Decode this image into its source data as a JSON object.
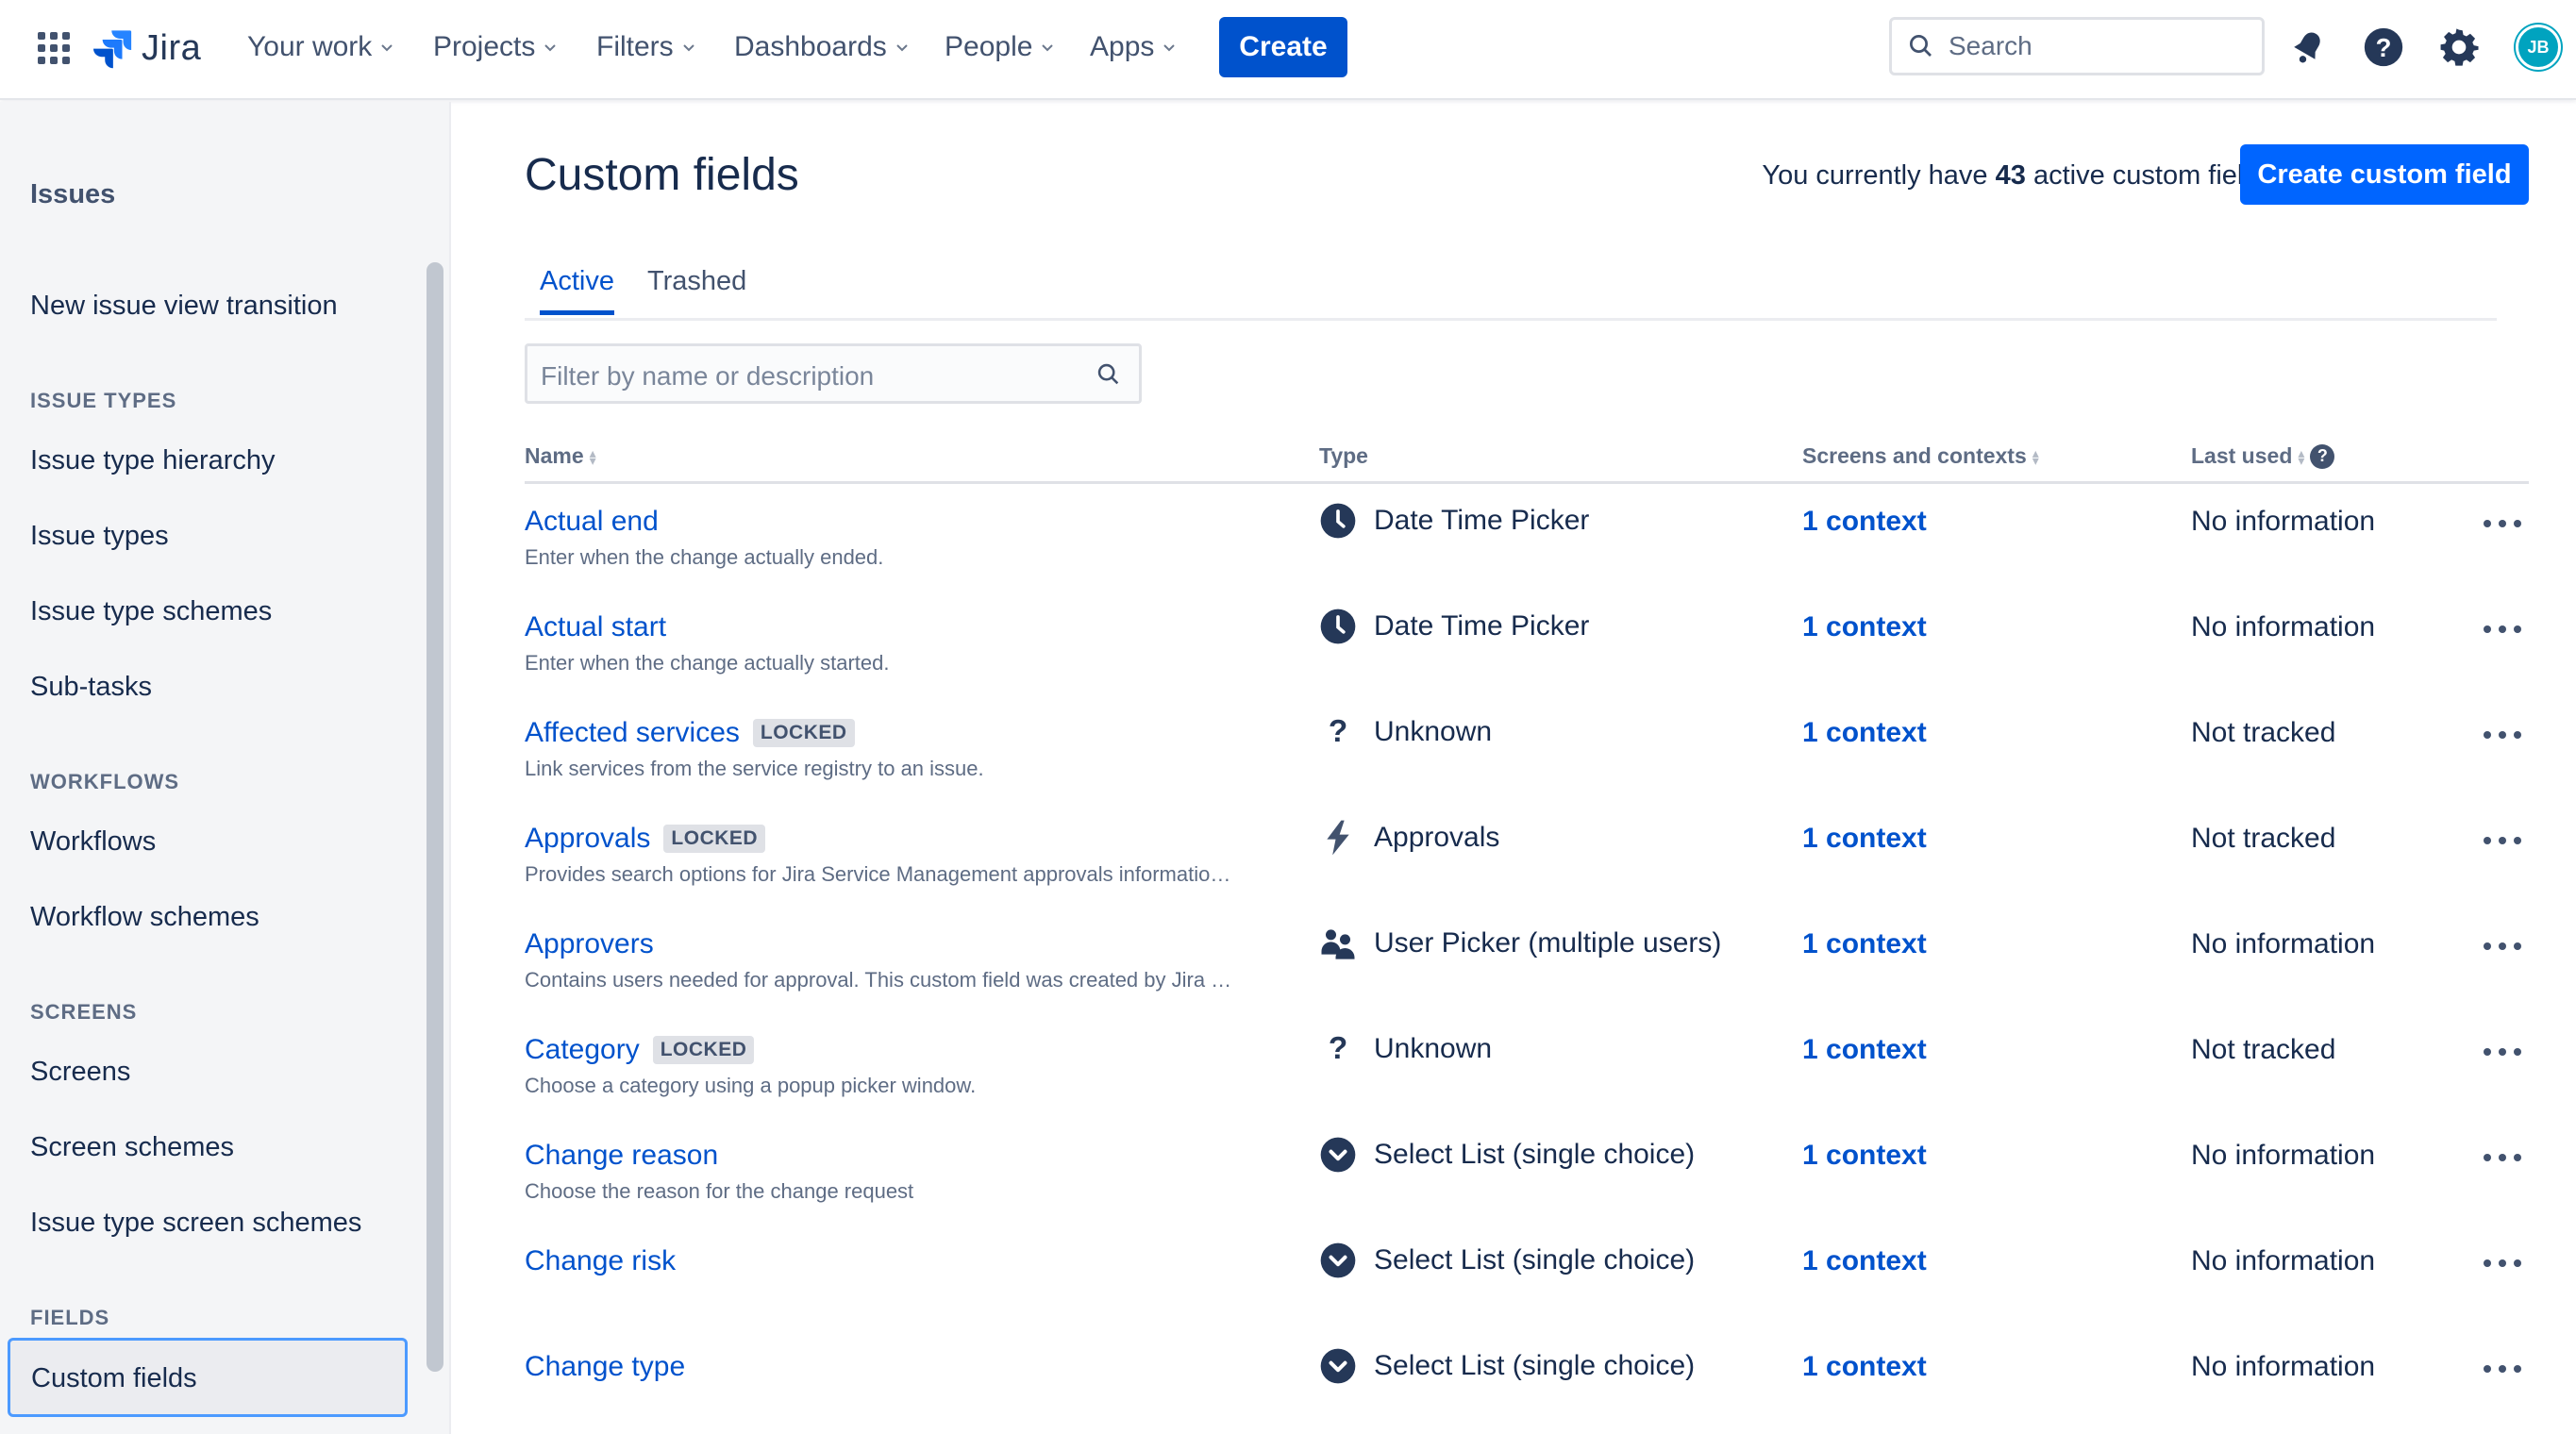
{
  "nav": {
    "product": "Jira",
    "items": [
      "Your work",
      "Projects",
      "Filters",
      "Dashboards",
      "People",
      "Apps"
    ],
    "create_label": "Create",
    "search_placeholder": "Search",
    "avatar_initials": "JB",
    "icons": [
      "app-switcher-icon",
      "jira-logo-icon",
      "notifications-icon",
      "help-icon",
      "settings-icon"
    ]
  },
  "sidebar": {
    "title": "Issues",
    "top_item": "New issue view transition",
    "sections": [
      {
        "heading": "ISSUE TYPES",
        "items": [
          "Issue type hierarchy",
          "Issue types",
          "Issue type schemes",
          "Sub-tasks"
        ]
      },
      {
        "heading": "WORKFLOWS",
        "items": [
          "Workflows",
          "Workflow schemes"
        ]
      },
      {
        "heading": "SCREENS",
        "items": [
          "Screens",
          "Screen schemes",
          "Issue type screen schemes"
        ]
      },
      {
        "heading": "FIELDS",
        "items": [
          "Custom fields"
        ]
      }
    ],
    "selected": "Custom fields"
  },
  "main": {
    "title": "Custom fields",
    "count_prefix": "You currently have",
    "count_value": "43",
    "count_suffix": "active custom fields",
    "create_button": "Create custom field",
    "tabs": [
      "Active",
      "Trashed"
    ],
    "active_tab": "Active",
    "filter_placeholder": "Filter by name or description",
    "columns": [
      "Name",
      "Type",
      "Screens and contexts",
      "Last used"
    ]
  },
  "rows": [
    {
      "name": "Actual end",
      "locked": false,
      "description": "Enter when the change actually ended.",
      "type": "Date Time Picker",
      "type_icon": "clock-icon",
      "context": "1 context",
      "last_used": "No information"
    },
    {
      "name": "Actual start",
      "locked": false,
      "description": "Enter when the change actually started.",
      "type": "Date Time Picker",
      "type_icon": "clock-icon",
      "context": "1 context",
      "last_used": "No information"
    },
    {
      "name": "Affected services",
      "locked": true,
      "locked_label": "LOCKED",
      "description": "Link services from the service registry to an issue.",
      "type": "Unknown",
      "type_icon": "question-icon",
      "context": "1 context",
      "last_used": "Not tracked"
    },
    {
      "name": "Approvals",
      "locked": true,
      "locked_label": "LOCKED",
      "description": "Provides search options for Jira Service Management approvals informatio…",
      "type": "Approvals",
      "type_icon": "lightning-icon",
      "context": "1 context",
      "last_used": "Not tracked"
    },
    {
      "name": "Approvers",
      "locked": false,
      "description": "Contains users needed for approval. This custom field was created by Jira …",
      "type": "User Picker (multiple users)",
      "type_icon": "users-icon",
      "context": "1 context",
      "last_used": "No information"
    },
    {
      "name": "Category",
      "locked": true,
      "locked_label": "LOCKED",
      "description": "Choose a category using a popup picker window.",
      "type": "Unknown",
      "type_icon": "question-icon",
      "context": "1 context",
      "last_used": "Not tracked"
    },
    {
      "name": "Change reason",
      "locked": false,
      "description": "Choose the reason for the change request",
      "type": "Select List (single choice)",
      "type_icon": "select-chevron-icon",
      "context": "1 context",
      "last_used": "No information"
    },
    {
      "name": "Change risk",
      "locked": false,
      "description": "",
      "type": "Select List (single choice)",
      "type_icon": "select-chevron-icon",
      "context": "1 context",
      "last_used": "No information"
    },
    {
      "name": "Change type",
      "locked": false,
      "description": "",
      "type": "Select List (single choice)",
      "type_icon": "select-chevron-icon",
      "context": "1 context",
      "last_used": "No information"
    }
  ]
}
